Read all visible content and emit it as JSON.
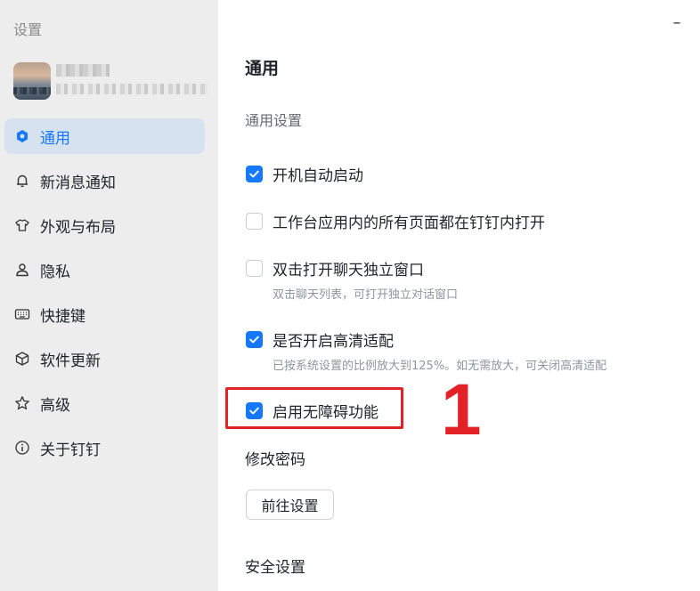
{
  "sidebar": {
    "title": "设置",
    "items": [
      {
        "label": "通用",
        "icon": "hexagon-icon",
        "active": true
      },
      {
        "label": "新消息通知",
        "icon": "bell-icon",
        "active": false
      },
      {
        "label": "外观与布局",
        "icon": "shirt-icon",
        "active": false
      },
      {
        "label": "隐私",
        "icon": "person-icon",
        "active": false
      },
      {
        "label": "快捷键",
        "icon": "keyboard-icon",
        "active": false
      },
      {
        "label": "软件更新",
        "icon": "box-icon",
        "active": false
      },
      {
        "label": "高级",
        "icon": "star-icon",
        "active": false
      },
      {
        "label": "关于钉钉",
        "icon": "info-icon",
        "active": false
      }
    ]
  },
  "window": {
    "minimize_label": "–"
  },
  "main": {
    "title": "通用",
    "section": "通用设置",
    "options": [
      {
        "label": "开机自动启动",
        "checked": true,
        "hint": ""
      },
      {
        "label": "工作台应用内的所有页面都在钉钉内打开",
        "checked": false,
        "hint": ""
      },
      {
        "label": "双击打开聊天独立窗口",
        "checked": false,
        "hint": "双击聊天列表，可打开独立对话窗口"
      },
      {
        "label": "是否开启高清适配",
        "checked": true,
        "hint": "已按系统设置的比例放大到125%。如无需放大，可关闭高清适配"
      },
      {
        "label": "启用无障碍功能",
        "checked": true,
        "hint": ""
      }
    ],
    "password_title": "修改密码",
    "password_button": "前往设置",
    "security_title": "安全设置"
  },
  "annotation": {
    "number": "1",
    "color": "#e32228"
  },
  "colors": {
    "accent": "#1677ff",
    "sidebar_bg": "#ededed",
    "active_bg": "#d6e2ef"
  }
}
